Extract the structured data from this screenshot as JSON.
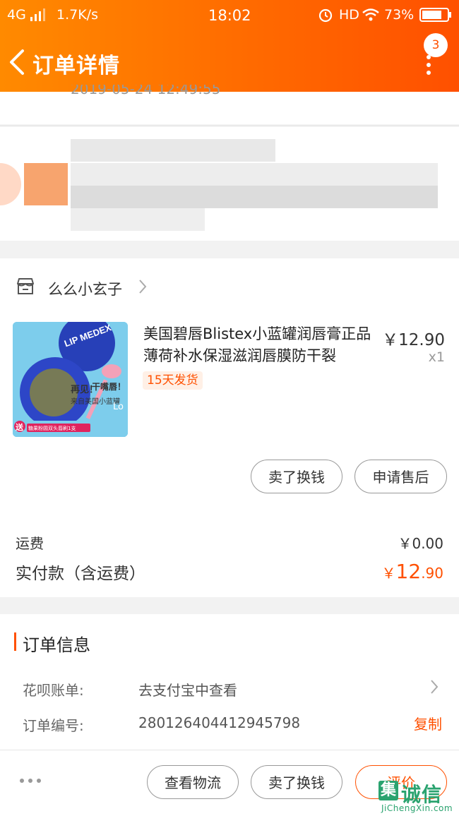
{
  "status_bar": {
    "network": "4G",
    "speed": "1.7K/s",
    "time": "18:02",
    "hd": "HD",
    "battery": "73%"
  },
  "nav": {
    "title": "订单详情",
    "badge_count": "3"
  },
  "order": {
    "time": "2019-05-24 12:49:55"
  },
  "shop": {
    "name": "么么小玄子"
  },
  "product": {
    "title": "美国碧唇Blistex小蓝罐润唇膏正品薄荷补水保湿滋润唇膜防干裂",
    "price": "￥12.90",
    "quantity": "x1",
    "ship_tag": "15天发货",
    "image_text_1": "再见！",
    "image_text_2": "干嘴唇！",
    "image_text_3": "来自美国小蓝罐",
    "image_text_4": "送",
    "image_text_5": "糖果粉圆双头唇刷1支",
    "image_text_6": "Lo",
    "image_brand": "LIP MEDEX"
  },
  "item_actions": {
    "sell_label": "卖了换钱",
    "aftersale_label": "申请售后"
  },
  "fees": {
    "shipping_label": "运费",
    "shipping_value": "￥0.00",
    "paid_label": "实付款（含运费）",
    "paid_symbol": "￥",
    "paid_int": "12",
    "paid_dec": ".90"
  },
  "order_info": {
    "title": "订单信息",
    "huabei_label": "花呗账单:",
    "huabei_value": "去支付宝中查看",
    "number_label": "订单编号:",
    "number_value": "280126404412945798",
    "copy_label": "复制"
  },
  "bottom_bar": {
    "logistics_label": "查看物流",
    "sell_label": "卖了换钱",
    "review_label": "评价"
  },
  "watermark": {
    "char": "集",
    "text": "诚信",
    "sub": "JiChengXin.com"
  },
  "colors": {
    "accent": "#ff5000",
    "header_start": "#ff8a00",
    "header_end": "#ff5000"
  }
}
